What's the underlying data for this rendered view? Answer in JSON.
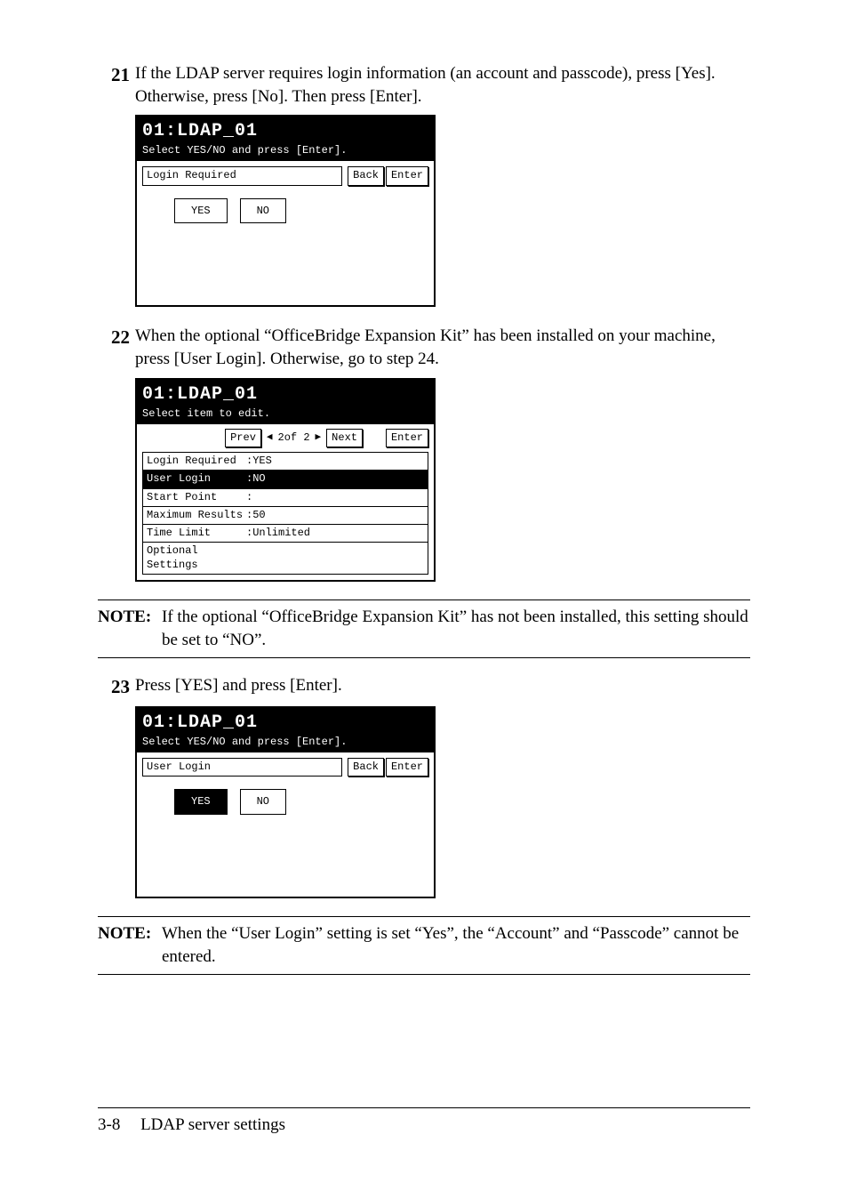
{
  "steps": {
    "s21": {
      "num": "21",
      "text": "If the LDAP server requires login information (an account and passcode), press [Yes]. Otherwise, press [No]. Then press [Enter]."
    },
    "s22": {
      "num": "22",
      "text": "When the optional “OfficeBridge Expansion Kit” has been installed on your machine, press [User Login]. Otherwise, go to step 24."
    },
    "s23": {
      "num": "23",
      "text": "Press [YES] and press [Enter]."
    }
  },
  "lcd1": {
    "title": "01:LDAP_01",
    "sub": "Select YES/NO and press [Enter].",
    "field": "Login Required",
    "back": "Back",
    "enter": "Enter",
    "yes": "YES",
    "no": "NO"
  },
  "lcd2": {
    "title": "01:LDAP_01",
    "sub": "Select item to edit.",
    "prev": "Prev",
    "next": "Next",
    "enter": "Enter",
    "page": "2of 2",
    "items": [
      {
        "lab": "Login Required",
        "val": ":YES"
      },
      {
        "lab": "User Login",
        "val": ":NO"
      },
      {
        "lab": "Start Point",
        "val": ":"
      },
      {
        "lab": "Maximum Results",
        "val": ":50"
      },
      {
        "lab": "Time Limit",
        "val": ":Unlimited"
      },
      {
        "lab": "Optional Settings",
        "val": ""
      }
    ]
  },
  "lcd3": {
    "title": "01:LDAP_01",
    "sub": "Select YES/NO and press [Enter].",
    "field": "User Login",
    "back": "Back",
    "enter": "Enter",
    "yes": "YES",
    "no": "NO"
  },
  "notes": {
    "label": "NOTE:",
    "n1": "If the optional “OfficeBridge Expansion Kit” has not been installed, this setting should be set to “NO”.",
    "n2": "When the “User Login” setting is set “Yes”, the “Account” and “Passcode” cannot be entered."
  },
  "footer": {
    "page": "3-8",
    "title": "LDAP server settings"
  }
}
